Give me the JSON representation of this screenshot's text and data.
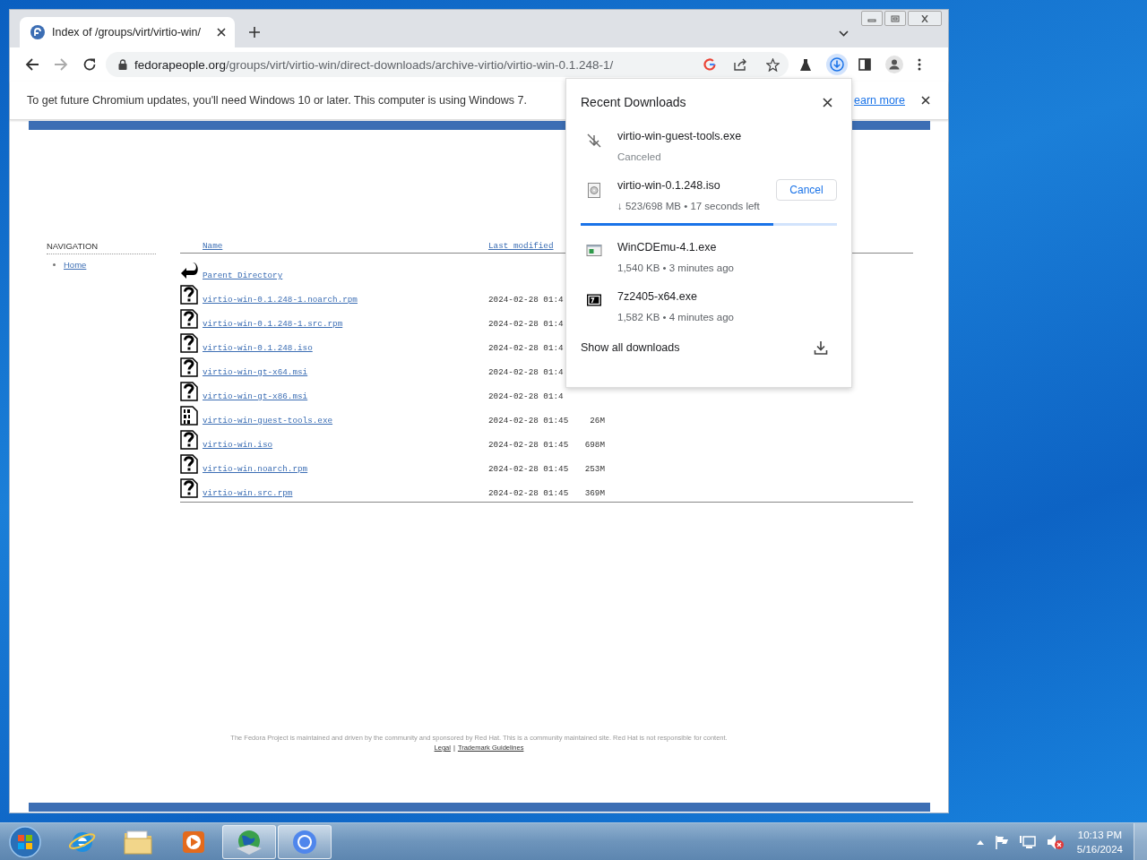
{
  "browser": {
    "tab": {
      "title": "Index of /groups/virt/virtio-win/",
      "selected": true
    },
    "address_bar": {
      "host": "fedorapeople.org",
      "path": "/groups/virt/virtio-win/direct-downloads/archive-virtio/virtio-win-0.1.248-1/"
    },
    "infobar": {
      "message": "To get future Chromium updates, you'll need Windows 10 or later. This computer is using Windows 7.",
      "link": "earn more"
    }
  },
  "page": {
    "navigation": {
      "title": "NAVIGATION",
      "items": [
        "Home"
      ]
    },
    "listing": {
      "columns": [
        "Name",
        "Last modified"
      ],
      "rows": [
        {
          "kind": "parent",
          "name": "Parent Directory"
        },
        {
          "kind": "file",
          "name": "virtio-win-0.1.248-1.noarch.rpm",
          "modified": "2024-02-28 01:4"
        },
        {
          "kind": "file",
          "name": "virtio-win-0.1.248-1.src.rpm",
          "modified": "2024-02-28 01:4"
        },
        {
          "kind": "file",
          "name": "virtio-win-0.1.248.iso",
          "modified": "2024-02-28 01:4"
        },
        {
          "kind": "file",
          "name": "virtio-win-gt-x64.msi",
          "modified": "2024-02-28 01:4"
        },
        {
          "kind": "file",
          "name": "virtio-win-gt-x86.msi",
          "modified": "2024-02-28 01:4"
        },
        {
          "kind": "binary",
          "name": "virtio-win-guest-tools.exe",
          "modified": "2024-02-28 01:45",
          "size": "26M"
        },
        {
          "kind": "file",
          "name": "virtio-win.iso",
          "modified": "2024-02-28 01:45",
          "size": "698M"
        },
        {
          "kind": "file",
          "name": "virtio-win.noarch.rpm",
          "modified": "2024-02-28 01:45",
          "size": "253M"
        },
        {
          "kind": "file",
          "name": "virtio-win.src.rpm",
          "modified": "2024-02-28 01:45",
          "size": "369M"
        }
      ]
    },
    "footer": {
      "notice": "The Fedora Project is maintained and driven by the community and sponsored by Red Hat. This is a community maintained site. Red Hat is not responsible for content.",
      "links": [
        "Legal",
        "Trademark Guidelines"
      ],
      "separator": "|"
    }
  },
  "downloads": {
    "title": "Recent Downloads",
    "items": [
      {
        "kind": "canceled",
        "name": "virtio-win-guest-tools.exe",
        "status": "Canceled"
      },
      {
        "kind": "in_progress",
        "name": "virtio-win-0.1.248.iso",
        "status": "↓ 523/698 MB • 17 seconds left",
        "action": "Cancel",
        "level": 0.75
      },
      {
        "kind": "complete",
        "name": "WinCDEmu-4.1.exe",
        "status": "1,540 KB • 3 minutes ago"
      },
      {
        "kind": "complete",
        "name": "7z2405-x64.exe",
        "status": "1,582 KB • 4 minutes ago"
      }
    ],
    "show_all": "Show all downloads"
  },
  "taskbar": {
    "apps": [
      {
        "running": false
      },
      {
        "running": false
      },
      {
        "running": false
      },
      {
        "running": true
      },
      {
        "running": true
      }
    ],
    "clock": {
      "time": "10:13 PM",
      "date": "5/16/2024"
    }
  }
}
